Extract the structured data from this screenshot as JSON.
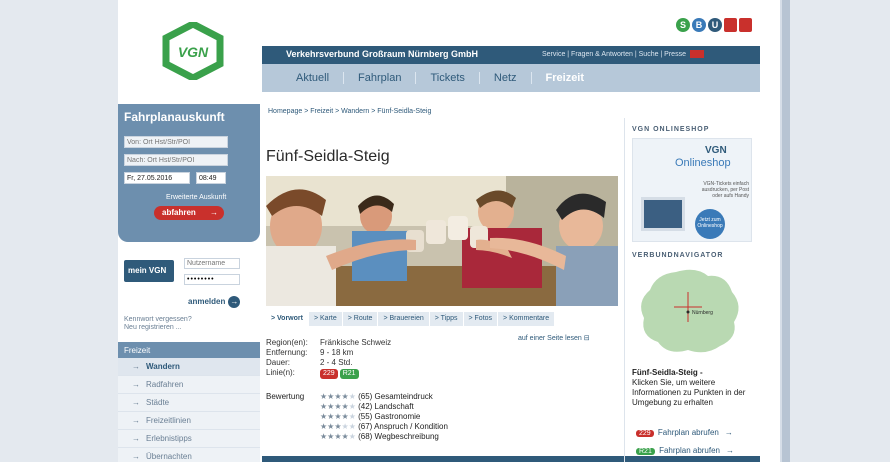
{
  "header": {
    "org_name": "Verkehrsverbund Großraum Nürnberg GmbH",
    "links": "Service | Fragen & Antworten | Suche | Presse",
    "icons": [
      {
        "label": "S",
        "color": "#3aa14b"
      },
      {
        "label": "B",
        "color": "#3a7ab8"
      },
      {
        "label": "U",
        "color": "#2f5a7a"
      },
      {
        "label": "",
        "color": "#c9302c"
      },
      {
        "label": "",
        "color": "#c9302c"
      }
    ]
  },
  "nav": {
    "items": [
      "Aktuell",
      "Fahrplan",
      "Tickets",
      "Netz",
      "Freizeit"
    ],
    "active": "Freizeit"
  },
  "logo": {
    "text": "VGN",
    "color": "#3aa14b"
  },
  "fahrplan": {
    "title": "Fahrplanauskunft",
    "from_placeholder": "Von: Ort Hst/Str/POI",
    "to_placeholder": "Nach: Ort Hst/Str/POI",
    "date": "Fr, 27.05.2016",
    "time": "08:49",
    "extended_link": "Erweiterte Auskunft",
    "button": "abfahren"
  },
  "login": {
    "brand": "mein VGN",
    "user_placeholder": "Nutzername",
    "password_value": "••••••••",
    "button": "anmelden",
    "forgot": "Kennwort vergessen?",
    "register": "Neu registrieren ..."
  },
  "freizeit_nav": {
    "heading": "Freizeit",
    "items": [
      "Wandern",
      "Radfahren",
      "Städte",
      "Freizeitlinien",
      "Erlebnistipps",
      "Übernachten"
    ],
    "active": "Wandern"
  },
  "breadcrumb": "Homepage > Freizeit > Wandern > Fünf-Seidla-Steig",
  "page_title": "Fünf-Seidla-Steig",
  "content_tabs": [
    "> Vorwort",
    "> Karte",
    "> Route",
    "> Brauereien",
    "> Tipps",
    "> Fotos",
    "> Kommentare"
  ],
  "one_page_link": "auf einer Seite lesen",
  "details": {
    "region_label": "Region(en):",
    "region_value": "Fränkische Schweiz",
    "distance_label": "Entfernung:",
    "distance_value": "9 - 18 km",
    "duration_label": "Dauer:",
    "duration_value": "2 - 4 Std.",
    "lines_label": "Linie(n):",
    "lines": [
      {
        "name": "229",
        "color": "#c9302c"
      },
      {
        "name": "R21",
        "color": "#3aa14b"
      }
    ]
  },
  "rating": {
    "label": "Bewertung",
    "items": [
      {
        "stars": 4,
        "count": "(65)",
        "name": "Gesamteindruck"
      },
      {
        "stars": 4,
        "count": "(42)",
        "name": "Landschaft"
      },
      {
        "stars": 4,
        "count": "(55)",
        "name": "Gastronomie"
      },
      {
        "stars": 3,
        "count": "(67)",
        "name": "Anspruch / Kondition"
      },
      {
        "stars": 4,
        "count": "(68)",
        "name": "Wegbeschreibung"
      }
    ]
  },
  "right_column": {
    "shop_heading": "VGN ONLINESHOP",
    "shop_brand": "VGN",
    "shop_title": "Onlineshop",
    "shop_text": "VGN-Tickets einfach ausdrucken, per Post oder aufs Handy",
    "shop_button": "Jetzt zum Onlineshop",
    "navigator_heading": "VERBUNDNAVIGATOR",
    "map_label": "Nürnberg",
    "map_title": "Fünf-Seidla-Steig -",
    "map_text": "Klicken Sie, um weitere Informationen zu Punkten in der Umgebung zu erhalten",
    "links": [
      {
        "line": "229",
        "color": "#c9302c",
        "text": "Fahrplan abrufen"
      },
      {
        "line": "R21",
        "color": "#3aa14b",
        "text": "Fahrplan abrufen"
      }
    ]
  }
}
